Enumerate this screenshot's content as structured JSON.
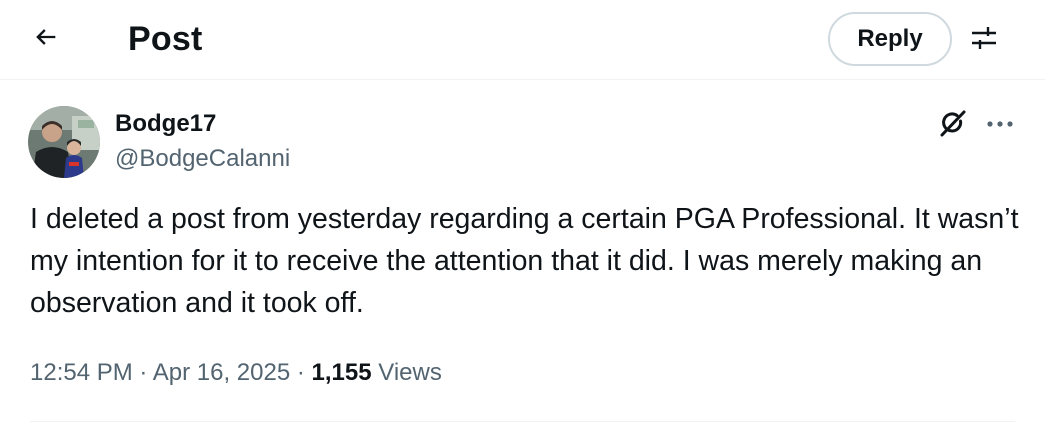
{
  "header": {
    "title": "Post",
    "back_icon": "arrow-left-icon",
    "reply_label": "Reply",
    "settings_icon": "sliders-icon"
  },
  "author": {
    "name": "Bodge17",
    "handle": "@BodgeCalanni",
    "avatar_icon": "avatar-photo"
  },
  "actions": {
    "grok_icon": "grok-icon",
    "more_icon": "more-horizontal-icon"
  },
  "post": {
    "text": "I deleted a post from yesterday regarding a certain PGA Professional. It wasn’t my intention for it to receive the attention that it did. I was merely making an observation and it took off."
  },
  "meta": {
    "time": "12:54 PM",
    "separator1": "·",
    "date": "Apr 16, 2025",
    "separator2": "·",
    "views_count": "1,155",
    "views_label": "Views"
  },
  "colors": {
    "text_primary": "#0f1419",
    "text_secondary": "#536471",
    "border": "#cfd9de",
    "divider": "#eff3f4"
  }
}
